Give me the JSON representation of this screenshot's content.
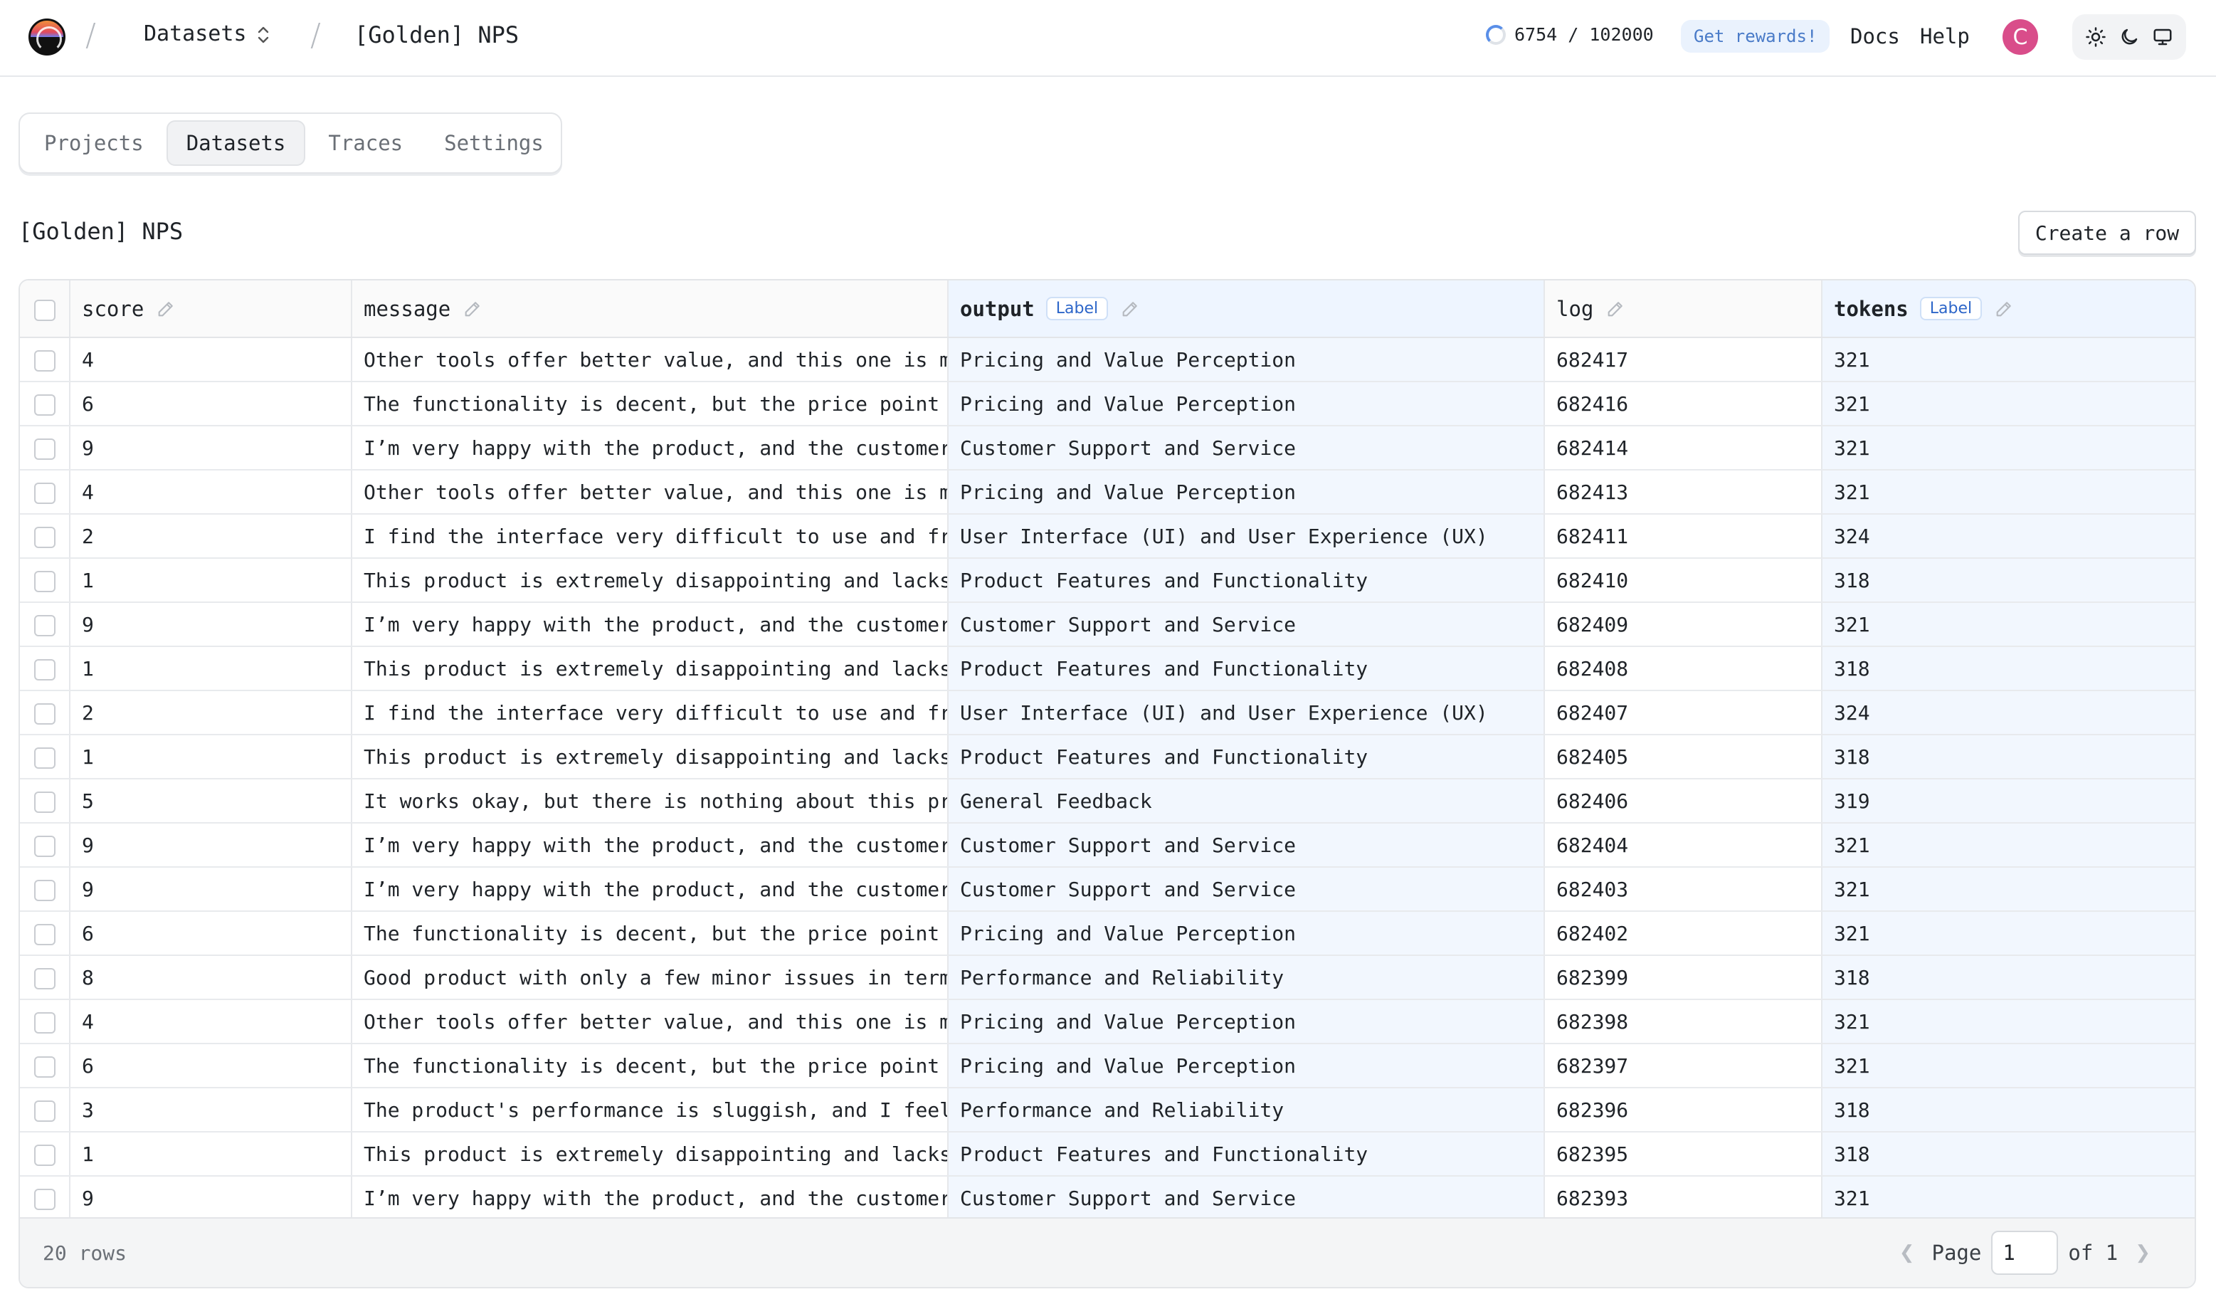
{
  "header": {
    "breadcrumb_datasets": "Datasets",
    "breadcrumb_current": "[Golden] NPS",
    "usage": "6754 / 102000",
    "rewards": "Get rewards!",
    "docs": "Docs",
    "help": "Help",
    "avatar_initial": "C",
    "theme_icons": [
      "sun-icon",
      "moon-icon",
      "monitor-icon"
    ]
  },
  "tabs": [
    {
      "label": "Projects",
      "active": false
    },
    {
      "label": "Datasets",
      "active": true
    },
    {
      "label": "Traces",
      "active": false
    },
    {
      "label": "Settings",
      "active": false
    }
  ],
  "page": {
    "title": "[Golden] NPS",
    "create_button": "Create a row"
  },
  "table": {
    "columns": [
      {
        "key": "score",
        "label": "score",
        "badge": ""
      },
      {
        "key": "message",
        "label": "message",
        "badge": ""
      },
      {
        "key": "output",
        "label": "output",
        "badge": "Label"
      },
      {
        "key": "log",
        "label": "log",
        "badge": ""
      },
      {
        "key": "tokens",
        "label": "tokens",
        "badge": "Label"
      }
    ],
    "rows": [
      {
        "score": "4",
        "message": "Other tools offer better value, and this one is m",
        "output": "Pricing and Value Perception",
        "log": "682417",
        "tokens": "321"
      },
      {
        "score": "6",
        "message": "The functionality is decent, but the price point ",
        "output": "Pricing and Value Perception",
        "log": "682416",
        "tokens": "321"
      },
      {
        "score": "9",
        "message": "I’m very happy with the product, and the customer",
        "output": "Customer Support and Service",
        "log": "682414",
        "tokens": "321"
      },
      {
        "score": "4",
        "message": "Other tools offer better value, and this one is m",
        "output": "Pricing and Value Perception",
        "log": "682413",
        "tokens": "321"
      },
      {
        "score": "2",
        "message": "I find the interface very difficult to use and fr",
        "output": "User Interface (UI) and User Experience (UX)",
        "log": "682411",
        "tokens": "324"
      },
      {
        "score": "1",
        "message": "This product is extremely disappointing and lacks",
        "output": "Product Features and Functionality",
        "log": "682410",
        "tokens": "318"
      },
      {
        "score": "9",
        "message": "I’m very happy with the product, and the customer",
        "output": "Customer Support and Service",
        "log": "682409",
        "tokens": "321"
      },
      {
        "score": "1",
        "message": "This product is extremely disappointing and lacks",
        "output": "Product Features and Functionality",
        "log": "682408",
        "tokens": "318"
      },
      {
        "score": "2",
        "message": "I find the interface very difficult to use and fr",
        "output": "User Interface (UI) and User Experience (UX)",
        "log": "682407",
        "tokens": "324"
      },
      {
        "score": "1",
        "message": "This product is extremely disappointing and lacks",
        "output": "Product Features and Functionality",
        "log": "682405",
        "tokens": "318"
      },
      {
        "score": "5",
        "message": "It works okay, but there is nothing about this pr",
        "output": "General Feedback",
        "log": "682406",
        "tokens": "319"
      },
      {
        "score": "9",
        "message": "I’m very happy with the product, and the customer",
        "output": "Customer Support and Service",
        "log": "682404",
        "tokens": "321"
      },
      {
        "score": "9",
        "message": "I’m very happy with the product, and the customer",
        "output": "Customer Support and Service",
        "log": "682403",
        "tokens": "321"
      },
      {
        "score": "6",
        "message": "The functionality is decent, but the price point ",
        "output": "Pricing and Value Perception",
        "log": "682402",
        "tokens": "321"
      },
      {
        "score": "8",
        "message": "Good product with only a few minor issues in term",
        "output": "Performance and Reliability",
        "log": "682399",
        "tokens": "318"
      },
      {
        "score": "4",
        "message": "Other tools offer better value, and this one is m",
        "output": "Pricing and Value Perception",
        "log": "682398",
        "tokens": "321"
      },
      {
        "score": "6",
        "message": "The functionality is decent, but the price point ",
        "output": "Pricing and Value Perception",
        "log": "682397",
        "tokens": "321"
      },
      {
        "score": "3",
        "message": "The product's performance is sluggish, and I feel",
        "output": "Performance and Reliability",
        "log": "682396",
        "tokens": "318"
      },
      {
        "score": "1",
        "message": "This product is extremely disappointing and lacks",
        "output": "Product Features and Functionality",
        "log": "682395",
        "tokens": "318"
      },
      {
        "score": "9",
        "message": "I’m very happy with the product, and the customer",
        "output": "Customer Support and Service",
        "log": "682393",
        "tokens": "321"
      }
    ]
  },
  "footer": {
    "row_count": "20 rows",
    "page_label": "Page",
    "page_value": "1",
    "of_label": "of 1"
  },
  "colors": {
    "label_header_bg": "#eef5ff",
    "label_cell_bg": "#f2f7fe",
    "avatar_bg": "#d94d8a",
    "accent": "#2d66c9"
  }
}
